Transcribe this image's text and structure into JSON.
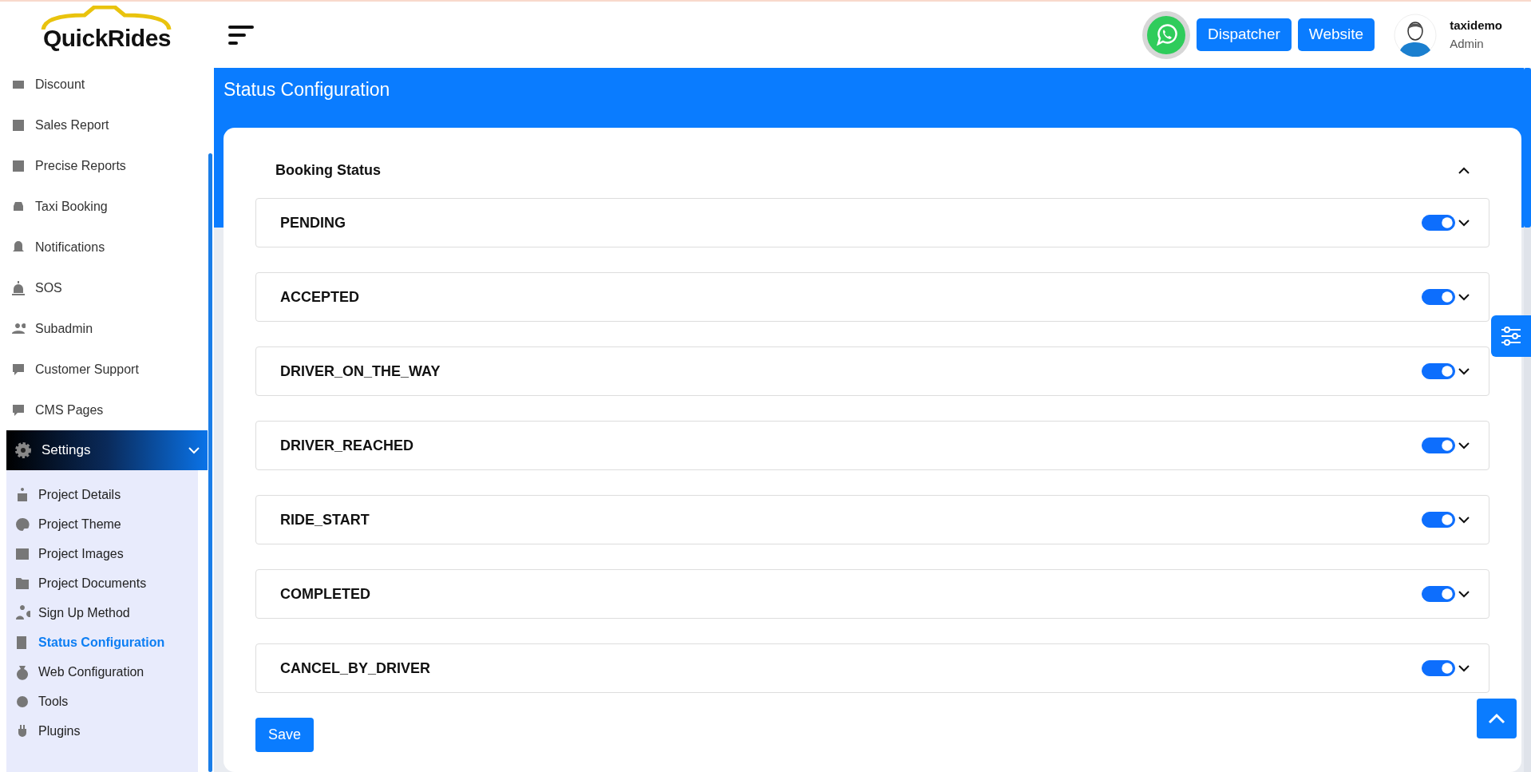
{
  "logo": {
    "first": "Quick",
    "second": "Rides"
  },
  "sidebar": {
    "items": [
      {
        "label": "Discount"
      },
      {
        "label": "Sales Report"
      },
      {
        "label": "Precise Reports"
      },
      {
        "label": "Taxi Booking"
      },
      {
        "label": "Notifications"
      },
      {
        "label": "SOS"
      },
      {
        "label": "Subadmin"
      },
      {
        "label": "Customer Support"
      },
      {
        "label": "CMS Pages"
      }
    ],
    "group": {
      "label": "Settings",
      "expanded": true,
      "children": [
        {
          "label": "Project Details",
          "selected": false
        },
        {
          "label": "Project Theme",
          "selected": false
        },
        {
          "label": "Project Images",
          "selected": false
        },
        {
          "label": "Project Documents",
          "selected": false
        },
        {
          "label": "Sign Up Method",
          "selected": false
        },
        {
          "label": "Status Configuration",
          "selected": true
        },
        {
          "label": "Web Configuration",
          "selected": false
        },
        {
          "label": "Tools",
          "selected": false
        },
        {
          "label": "Plugins",
          "selected": false
        }
      ]
    }
  },
  "header": {
    "buttons": [
      "Dispatcher",
      "Website"
    ],
    "user": {
      "name": "taxidemo",
      "role": "Admin"
    }
  },
  "page_title": "Status Configuration",
  "section": {
    "title": "Booking Status",
    "expanded": true
  },
  "statuses": [
    {
      "label": "PENDING",
      "on": true
    },
    {
      "label": "ACCEPTED",
      "on": true
    },
    {
      "label": "DRIVER_ON_THE_WAY",
      "on": true
    },
    {
      "label": "DRIVER_REACHED",
      "on": true
    },
    {
      "label": "RIDE_START",
      "on": true
    },
    {
      "label": "COMPLETED",
      "on": true
    },
    {
      "label": "CANCEL_BY_DRIVER",
      "on": true
    }
  ],
  "save_button": "Save"
}
